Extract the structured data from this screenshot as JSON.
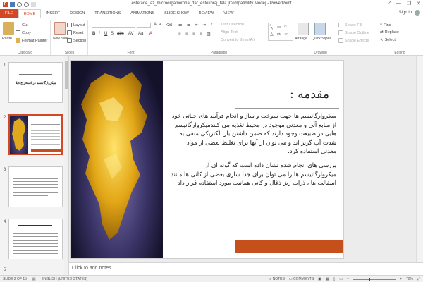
{
  "window": {
    "title": "estefade_az_microorganiomha_dar_estekhraj_tala [Compatibility Mode] - PowerPoint",
    "sign_in": "Sign in",
    "minimize": "—",
    "restore": "❐",
    "close": "✕",
    "help": "?"
  },
  "tabs": [
    "FILE",
    "HOME",
    "INSERT",
    "DESIGN",
    "TRANSITIONS",
    "ANIMATIONS",
    "SLIDE SHOW",
    "REVIEW",
    "VIEW"
  ],
  "ribbon": {
    "clipboard": {
      "label": "Clipboard",
      "paste": "Paste",
      "cut": "Cut",
      "copy": "Copy",
      "format_painter": "Format Painter"
    },
    "slides": {
      "label": "Slides",
      "new_slide": "New Slide",
      "layout": "Layout",
      "reset": "Reset",
      "section": "Section"
    },
    "font": {
      "label": "Font",
      "font_name": "",
      "font_size": ""
    },
    "paragraph": {
      "label": "Paragraph",
      "text_direction": "Text Direction",
      "align_text": "Align Text",
      "convert_smartart": "Convert to SmartArt"
    },
    "drawing": {
      "label": "Drawing",
      "arrange": "Arrange",
      "quick_styles": "Quick Styles",
      "shape_fill": "Shape Fill",
      "shape_outline": "Shape Outline",
      "shape_effects": "Shape Effects"
    },
    "editing": {
      "label": "Editing",
      "find": "Find",
      "replace": "Replace",
      "select": "Select"
    }
  },
  "thumbnails": {
    "numbers": [
      "1",
      "2",
      "3",
      "4",
      "5"
    ],
    "slide1_title": "میکروارگانیسم در استخراج طلا"
  },
  "slide": {
    "heading": "مقدمه :",
    "paragraph1": "میکروارگانیسم ها جهت سوخت و ساز و انجام فرآیند های حیاتی خود از منابع آلی و معدنی موجود در محیط تغذیه می کنندمیکروارگانیسم هایی در طبیعت وجود دارند که ضمن داشتن بار الکتریکی منفی به شدت آب گریز اند و می توان از آنها برای تغلیظ بعضی از مواد معدنی استفاده کرد.",
    "paragraph2": "بررسی های انجام شده نشان داده است که گونه ای از میکروارگانیسم ها را می توان برای جدا سازی بعضی از کانی ها مانند اسفالت ها ، ذرات ریز ذغال و کانی همانیت مورد استفاده قرار داد"
  },
  "notes_placeholder": "Click to add notes",
  "statusbar": {
    "slide_count": "SLIDE 2 OF 15",
    "language": "ENGLISH (UNITED STATES)",
    "notes": "NOTES",
    "comments": "COMMENTS",
    "zoom": "70%"
  },
  "colors": {
    "accent": "#d24726",
    "slide_bar": "#c5501c"
  }
}
